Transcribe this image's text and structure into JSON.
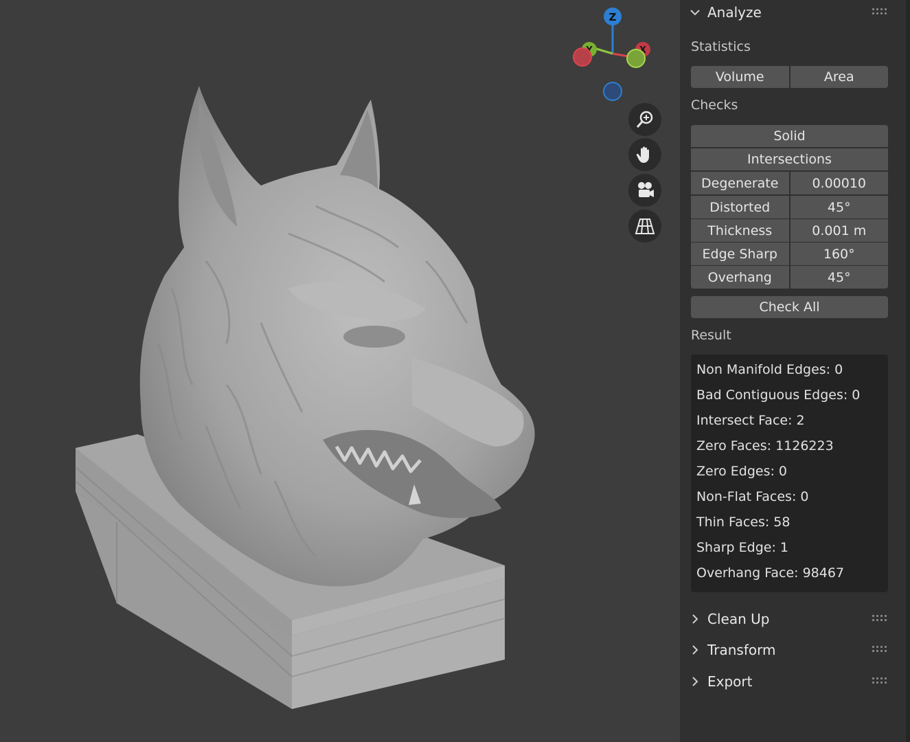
{
  "viewport": {
    "gizmo": {
      "z_label": "Z",
      "y_label": "Y",
      "x_label": "X"
    },
    "nav_buttons": [
      "zoom-icon",
      "hand-icon",
      "camera-icon",
      "grid-icon"
    ]
  },
  "sidebar": {
    "analyze": {
      "title": "Analyze",
      "statistics_label": "Statistics",
      "volume": "Volume",
      "area": "Area",
      "checks_label": "Checks",
      "solid": "Solid",
      "intersections": "Intersections",
      "checks": [
        {
          "label": "Degenerate",
          "value": "0.00010"
        },
        {
          "label": "Distorted",
          "value": "45°"
        },
        {
          "label": "Thickness",
          "value": "0.001 m"
        },
        {
          "label": "Edge Sharp",
          "value": "160°"
        },
        {
          "label": "Overhang",
          "value": "45°"
        }
      ],
      "check_all": "Check All",
      "result_label": "Result",
      "results": [
        "Non Manifold Edges: 0",
        "Bad Contiguous Edges: 0",
        "Intersect Face: 2",
        "Zero Faces: 1126223",
        "Zero Edges: 0",
        "Non-Flat Faces: 0",
        "Thin Faces: 58",
        "Sharp Edge: 1",
        "Overhang Face: 98467"
      ]
    },
    "collapsed_panels": [
      "Clean Up",
      "Transform",
      "Export"
    ]
  },
  "colors": {
    "background": "#3d3d3d",
    "sidebar": "#303030",
    "button": "#545454",
    "result_box": "#232323",
    "axis_x": "#d9454f",
    "axis_y": "#8cc63f",
    "axis_z": "#2d7fd3"
  }
}
